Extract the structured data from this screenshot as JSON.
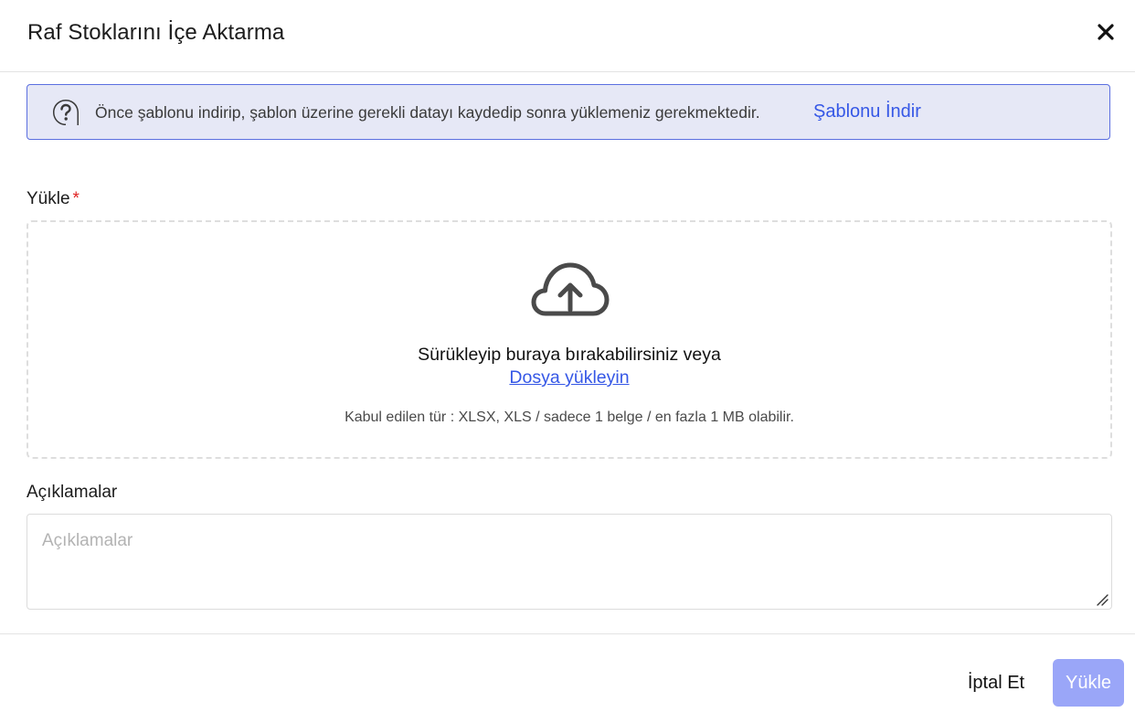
{
  "modal": {
    "title": "Raf Stoklarını İçe Aktarma"
  },
  "info_banner": {
    "text": "Önce şablonu indirip, şablon üzerine gerekli datayı kaydedip sonra yüklemeniz gerekmektedir.",
    "link_label": "Şablonu İndir",
    "icon": "question-icon"
  },
  "upload": {
    "label": "Yükle",
    "required_mark": "*",
    "icon": "cloud-upload-icon",
    "drop_text": "Sürükleyip buraya bırakabilirsiniz veya",
    "link_label": "Dosya yükleyin",
    "hint": "Kabul edilen tür : XLSX, XLS / sadece 1 belge / en fazla 1 MB olabilir."
  },
  "description": {
    "label": "Açıklamalar",
    "placeholder": "Açıklamalar",
    "value": ""
  },
  "footer": {
    "cancel_label": "İptal Et",
    "submit_label": "Yükle"
  },
  "colors": {
    "accent": "#3557e6",
    "banner_bg": "#e6e8f6",
    "banner_border": "#5b6fe0",
    "submit_disabled_bg": "#9aa6f8",
    "required": "#e02424"
  }
}
